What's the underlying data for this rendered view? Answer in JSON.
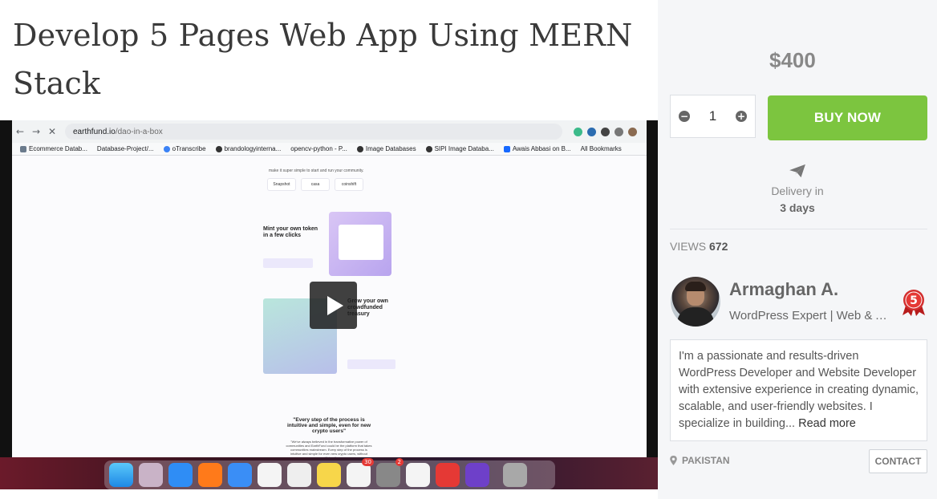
{
  "gig": {
    "title": "Develop 5 Pages Web App Using MERN Stack"
  },
  "video": {
    "browser": {
      "url_domain": "earthfund.io",
      "url_path": "/dao-in-a-box",
      "bookmarks": [
        "Ecommerce Datab...",
        "Database-Project/...",
        "oTranscribe",
        "brandologyinterna...",
        "opencv-python - P...",
        "Image Databases",
        "SIPI Image Databa...",
        "Awais Abbasi on B...",
        "All Bookmarks"
      ]
    },
    "site": {
      "tagline": "make it super simple to start and run your community.",
      "partners": [
        "Snapshot",
        "casa",
        "coinshift"
      ],
      "feature1_title": "Mint your own token in a few clicks",
      "feature2_title": "Grow your own crowdfunded treasury",
      "quote": "\"Every step of the process is intuitive and simple, even for new crypto users\"",
      "quote_sub": "\"We've always believed in the transformative power of communities and EarthFund could be the platform that takes communities mainstream. Every step of the process is intuitive and simple for even new crypto users, without sacrificing the"
    },
    "dock_badges": [
      "30",
      "2"
    ]
  },
  "sidebar": {
    "price": "$400",
    "quantity": "1",
    "buy_label": "BUY NOW",
    "delivery_label": "Delivery in",
    "delivery_days": "3 days",
    "views_label": "VIEWS",
    "views_count": "672",
    "seller": {
      "name": "Armaghan A.",
      "title": "WordPress Expert | Web & A...",
      "level": "5",
      "bio": "I'm a passionate and results-driven WordPress Developer and Website Developer with extensive experience in creating dynamic, scalable, and user-friendly websites. I specialize in building...",
      "read_more": "Read more",
      "country": "PAKISTAN",
      "contact_label": "CONTACT"
    }
  },
  "colors": {
    "buy_button": "#7cc53f",
    "sidebar_bg": "#f5f6f8",
    "level_badge": "#d32f2f"
  }
}
